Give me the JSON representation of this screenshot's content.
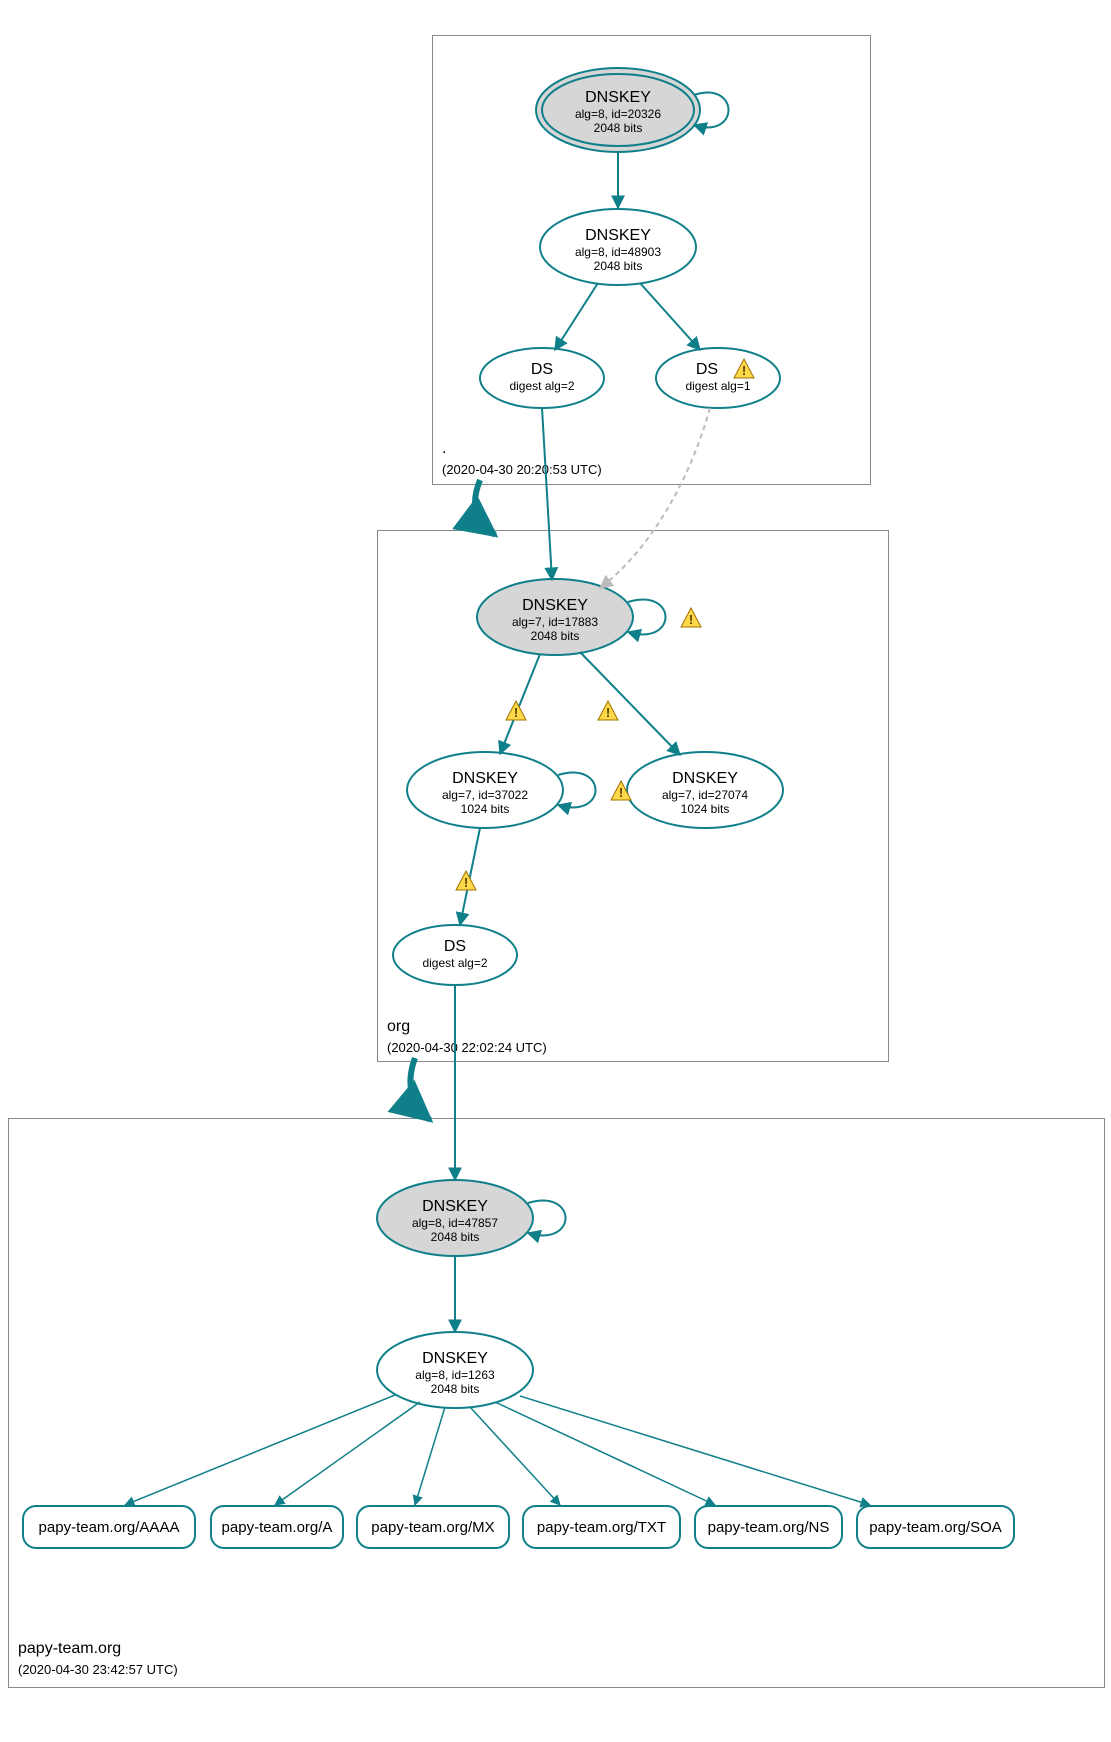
{
  "colors": {
    "stroke": "#0f7f8a",
    "fillKey": "#d6d6d6",
    "fillPlain": "#ffffff"
  },
  "zones": {
    "root": {
      "name": ".",
      "timestamp": "(2020-04-30 20:20:53 UTC)"
    },
    "org": {
      "name": "org",
      "timestamp": "(2020-04-30 22:02:24 UTC)"
    },
    "domain": {
      "name": "papy-team.org",
      "timestamp": "(2020-04-30 23:42:57 UTC)"
    }
  },
  "nodes": {
    "root_ksk": {
      "title": "DNSKEY",
      "line2": "alg=8, id=20326",
      "line3": "2048 bits"
    },
    "root_zsk": {
      "title": "DNSKEY",
      "line2": "alg=8, id=48903",
      "line3": "2048 bits"
    },
    "root_ds1": {
      "title": "DS",
      "line2": "digest alg=2"
    },
    "root_ds2": {
      "title": "DS",
      "line2": "digest alg=1"
    },
    "org_ksk": {
      "title": "DNSKEY",
      "line2": "alg=7, id=17883",
      "line3": "2048 bits"
    },
    "org_zsk1": {
      "title": "DNSKEY",
      "line2": "alg=7, id=37022",
      "line3": "1024 bits"
    },
    "org_zsk2": {
      "title": "DNSKEY",
      "line2": "alg=7, id=27074",
      "line3": "1024 bits"
    },
    "org_ds": {
      "title": "DS",
      "line2": "digest alg=2"
    },
    "dom_ksk": {
      "title": "DNSKEY",
      "line2": "alg=8, id=47857",
      "line3": "2048 bits"
    },
    "dom_zsk": {
      "title": "DNSKEY",
      "line2": "alg=8, id=1263",
      "line3": "2048 bits"
    }
  },
  "records": {
    "aaaa": "papy-team.org/AAAA",
    "a": "papy-team.org/A",
    "mx": "papy-team.org/MX",
    "txt": "papy-team.org/TXT",
    "ns": "papy-team.org/NS",
    "soa": "papy-team.org/SOA"
  }
}
